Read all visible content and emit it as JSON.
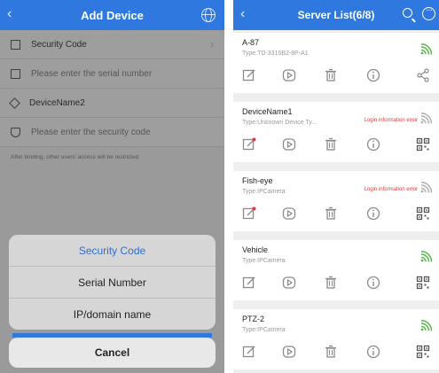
{
  "left": {
    "header": {
      "title": "Add Device"
    },
    "rows": [
      {
        "label": "Security Code",
        "placeholder": false
      },
      {
        "label": "Please enter the serial number",
        "placeholder": true
      },
      {
        "label": "DeviceName2",
        "placeholder": false
      },
      {
        "label": "Please enter the security code",
        "placeholder": true
      }
    ],
    "note": "After binding, other users' access will be restricted",
    "sheet": {
      "options": [
        "Security Code",
        "Serial Number",
        "IP/domain name"
      ],
      "cancel": "Cancel"
    }
  },
  "right": {
    "header": {
      "title": "Server List(6/8)"
    },
    "devices": [
      {
        "name": "A-87",
        "type": "Type:TD-3316B2-8P-A1",
        "error": "",
        "wifi_color": "#52b84a",
        "edit_alert": false
      },
      {
        "name": "DeviceName1",
        "type": "Type:Unknown Device Ty...",
        "error": "Login information error",
        "wifi_color": "#b0b0b0",
        "edit_alert": true
      },
      {
        "name": "Fish-eye",
        "type": "Type:IPCamera",
        "error": "Login information error",
        "wifi_color": "#b0b0b0",
        "edit_alert": true
      },
      {
        "name": "Vehicle",
        "type": "Type:IPCamera",
        "error": "",
        "wifi_color": "#52b84a",
        "edit_alert": false
      },
      {
        "name": "PTZ-2",
        "type": "Type:IPCamera",
        "error": "",
        "wifi_color": "#52b84a",
        "edit_alert": false
      }
    ]
  },
  "colors": {
    "accent": "#2e78e0",
    "error": "#e23a3a",
    "online": "#52b84a"
  }
}
